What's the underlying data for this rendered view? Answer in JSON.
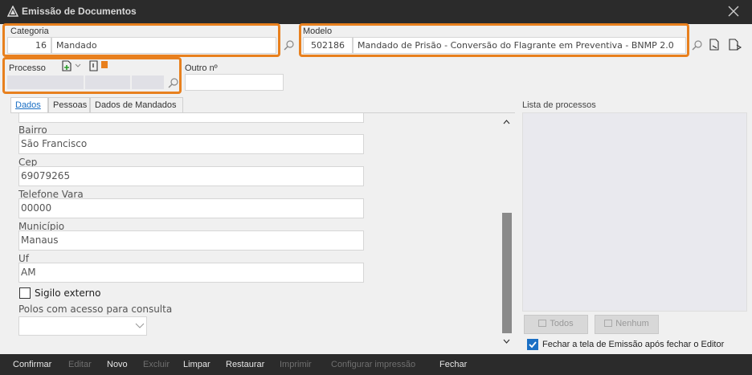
{
  "window": {
    "title": "Emissão de Documentos"
  },
  "categoria": {
    "label": "Categoria",
    "code": "16",
    "value": "Mandado"
  },
  "modelo": {
    "label": "Modelo",
    "code": "502186",
    "value": "Mandado de Prisão - Conversão do Flagrante em Preventiva - BNMP 2.0"
  },
  "processo": {
    "label": "Processo"
  },
  "outro": {
    "label": "Outro nº",
    "value": ""
  },
  "tabs": [
    {
      "label": "Dados"
    },
    {
      "label": "Pessoas"
    },
    {
      "label": "Dados de Mandados"
    }
  ],
  "form": {
    "bairro": {
      "label": "Bairro",
      "value": "São Francisco"
    },
    "cep": {
      "label": "Cep",
      "value": "69079265"
    },
    "telefone": {
      "label": "Telefone Vara",
      "value": "00000"
    },
    "municipio": {
      "label": "Município",
      "value": "Manaus"
    },
    "uf": {
      "label": "Uf",
      "value": "AM"
    },
    "sigilo": {
      "label": "Sigilo externo",
      "checked": false
    },
    "polos": {
      "label": "Polos com acesso para consulta",
      "value": ""
    }
  },
  "lista": {
    "label": "Lista de processos",
    "todos": "Todos",
    "nenhum": "Nenhum"
  },
  "fechar_tela": {
    "label": "Fechar a tela de Emissão após fechar o Editor",
    "checked": true
  },
  "footer": {
    "confirmar": "Confirmar",
    "editar": "Editar",
    "novo": "Novo",
    "excluir": "Excluir",
    "limpar": "Limpar",
    "restaurar": "Restaurar",
    "imprimir": "Imprimir",
    "configurar": "Configurar impressão",
    "fechar": "Fechar"
  },
  "colors": {
    "highlight": "#e8801e",
    "titlebar": "#2b2b2b",
    "accent": "#1a6fc4"
  }
}
